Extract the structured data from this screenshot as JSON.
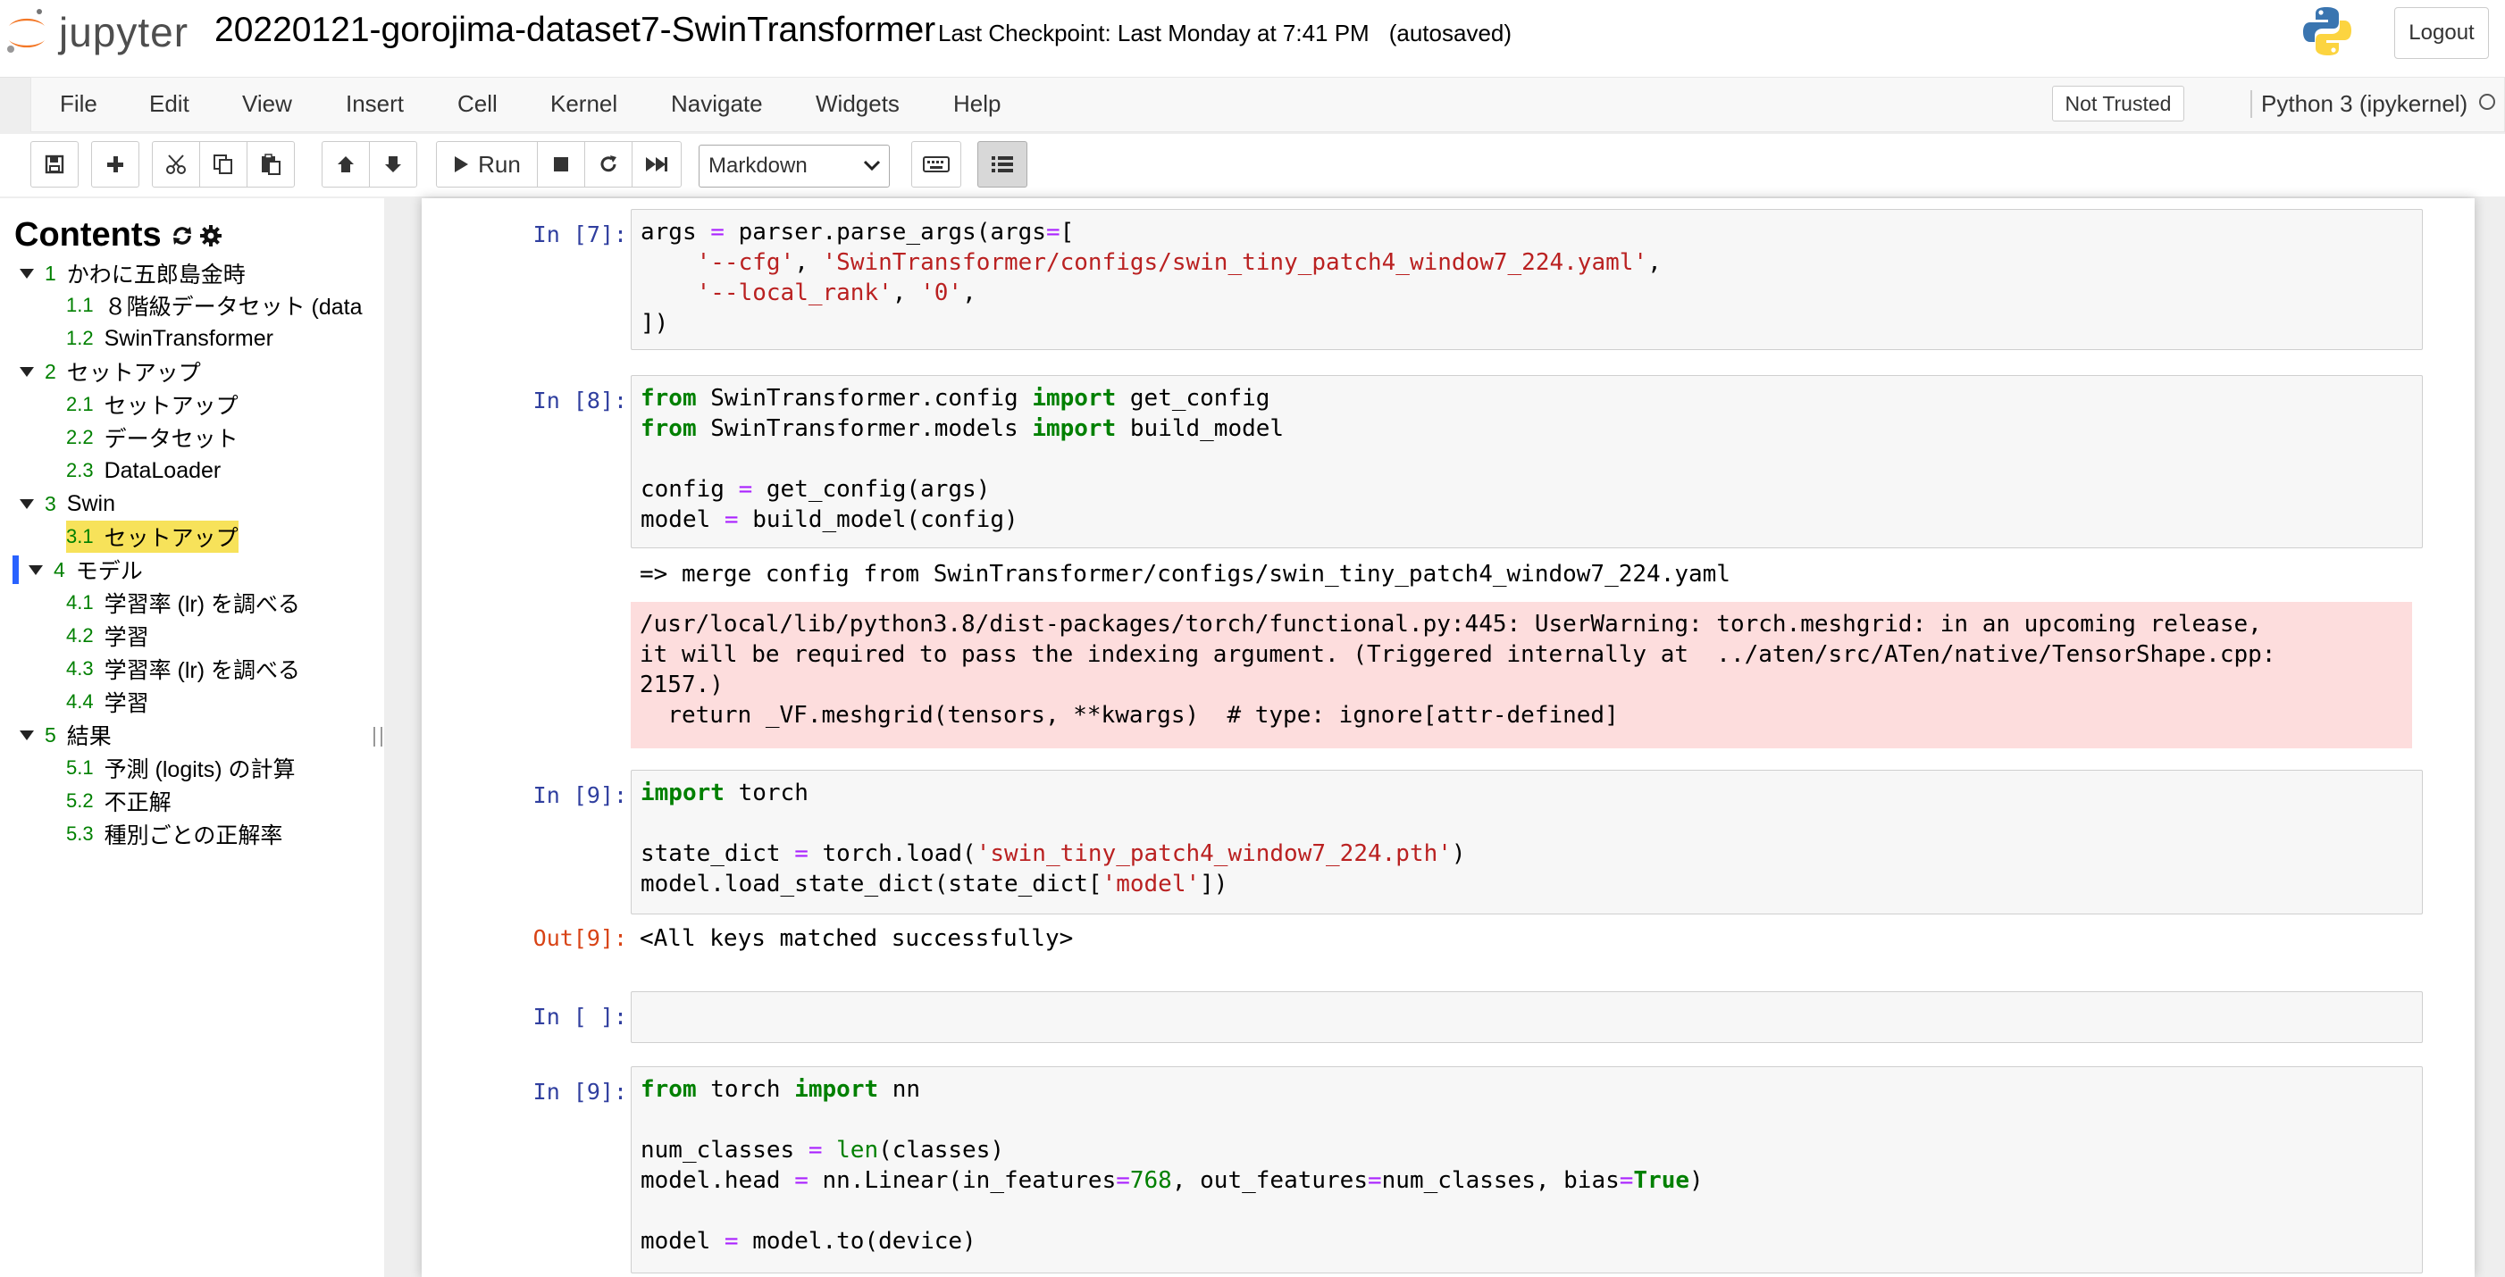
{
  "header": {
    "logo_text": "jupyter",
    "notebook_title": "20220121-gorojima-dataset7-SwinTransformer",
    "checkpoint": "Last Checkpoint: Last Monday at 7:41 PM",
    "autosaved": "(autosaved)",
    "logout_label": "Logout"
  },
  "menubar": {
    "items": [
      "File",
      "Edit",
      "View",
      "Insert",
      "Cell",
      "Kernel",
      "Navigate",
      "Widgets",
      "Help"
    ],
    "trust_label": "Not Trusted",
    "kernel_name": "Python 3 (ipykernel)"
  },
  "toolbar": {
    "run_label": "Run",
    "cell_type": "Markdown",
    "buttons": [
      "save-icon",
      "plus-icon",
      "cut-icon",
      "copy-icon",
      "paste-icon",
      "arrow-up-icon",
      "arrow-down-icon",
      "run-icon",
      "stop-icon",
      "restart-icon",
      "fast-forward-icon",
      "keyboard-icon",
      "toc-list-icon"
    ]
  },
  "toc": {
    "title": "Contents",
    "items": [
      {
        "num": "1",
        "label": "かわに五郎島金時",
        "level": 1
      },
      {
        "num": "1.1",
        "label": "８階級データセット (data",
        "level": 2
      },
      {
        "num": "1.2",
        "label": "SwinTransformer",
        "level": 2
      },
      {
        "num": "2",
        "label": "セットアップ",
        "level": 1
      },
      {
        "num": "2.1",
        "label": "セットアップ",
        "level": 2
      },
      {
        "num": "2.2",
        "label": "データセット",
        "level": 2
      },
      {
        "num": "2.3",
        "label": "DataLoader",
        "level": 2
      },
      {
        "num": "3",
        "label": "Swin",
        "level": 1
      },
      {
        "num": "3.1",
        "label": "セットアップ",
        "level": 2,
        "highlighted": true
      },
      {
        "num": "4",
        "label": "モデル",
        "level": 1,
        "current": true
      },
      {
        "num": "4.1",
        "label": "学習率 (lr) を調べる",
        "level": 2
      },
      {
        "num": "4.2",
        "label": "学習",
        "level": 2
      },
      {
        "num": "4.3",
        "label": "学習率 (lr) を調べる",
        "level": 2
      },
      {
        "num": "4.4",
        "label": "学習",
        "level": 2
      },
      {
        "num": "5",
        "label": "結果",
        "level": 1
      },
      {
        "num": "5.1",
        "label": "予測 (logits) の計算",
        "level": 2
      },
      {
        "num": "5.2",
        "label": "不正解",
        "level": 2
      },
      {
        "num": "5.3",
        "label": "種別ごとの正解率",
        "level": 2
      }
    ]
  },
  "cells": {
    "c7": {
      "prompt": "In [7]:",
      "lines": [
        [
          [
            "args ",
            ""
          ],
          [
            "=",
            "op"
          ],
          [
            " parser.parse_args(args",
            ""
          ],
          [
            "=",
            "op"
          ],
          [
            "[",
            ""
          ]
        ],
        [
          [
            "    ",
            ""
          ],
          [
            "'--cfg'",
            "str"
          ],
          [
            ", ",
            ""
          ],
          [
            "'SwinTransformer/configs/swin_tiny_patch4_window7_224.yaml'",
            "str"
          ],
          [
            ",",
            ""
          ]
        ],
        [
          [
            "    ",
            ""
          ],
          [
            "'--local_rank'",
            "str"
          ],
          [
            ", ",
            ""
          ],
          [
            "'0'",
            "str"
          ],
          [
            ",",
            ""
          ]
        ],
        [
          [
            "])",
            ""
          ]
        ]
      ]
    },
    "c8": {
      "prompt": "In [8]:",
      "lines": [
        [
          [
            "from",
            "kw"
          ],
          [
            " SwinTransformer.config ",
            ""
          ],
          [
            "import",
            "kw"
          ],
          [
            " get_config",
            ""
          ]
        ],
        [
          [
            "from",
            "kw"
          ],
          [
            " SwinTransformer.models ",
            ""
          ],
          [
            "import",
            "kw"
          ],
          [
            " build_model",
            ""
          ]
        ],
        [
          [
            "",
            ""
          ]
        ],
        [
          [
            "config ",
            ""
          ],
          [
            "=",
            "op"
          ],
          [
            " get_config(args)",
            ""
          ]
        ],
        [
          [
            "model ",
            ""
          ],
          [
            "=",
            "op"
          ],
          [
            " build_model(config)",
            ""
          ]
        ]
      ],
      "stdout": "=> merge config from SwinTransformer/configs/swin_tiny_patch4_window7_224.yaml",
      "stderr": [
        "/usr/local/lib/python3.8/dist-packages/torch/functional.py:445: UserWarning: torch.meshgrid: in an upcoming release,",
        "it will be required to pass the indexing argument. (Triggered internally at  ../aten/src/ATen/native/TensorShape.cpp:",
        "2157.)",
        "  return _VF.meshgrid(tensors, **kwargs)  # type: ignore[attr-defined]"
      ]
    },
    "c9a": {
      "prompt": "In [9]:",
      "lines": [
        [
          [
            "import",
            "kw"
          ],
          [
            " torch",
            ""
          ]
        ],
        [
          [
            "",
            ""
          ]
        ],
        [
          [
            "state_dict ",
            ""
          ],
          [
            "=",
            "op"
          ],
          [
            " torch.load(",
            ""
          ],
          [
            "'swin_tiny_patch4_window7_224.pth'",
            "str"
          ],
          [
            ")",
            ""
          ]
        ],
        [
          [
            "model.load_state_dict(state_dict[",
            ""
          ],
          [
            "'model'",
            "str"
          ],
          [
            "])",
            ""
          ]
        ]
      ],
      "out_prompt": "Out[9]:",
      "output": "<All keys matched successfully>"
    },
    "c_empty": {
      "prompt": "In [ ]:"
    },
    "c9b": {
      "prompt": "In [9]:",
      "lines": [
        [
          [
            "from",
            "kw"
          ],
          [
            " torch ",
            ""
          ],
          [
            "import",
            "kw"
          ],
          [
            " nn",
            ""
          ]
        ],
        [
          [
            "",
            ""
          ]
        ],
        [
          [
            "num_classes ",
            ""
          ],
          [
            "=",
            "op"
          ],
          [
            " ",
            ""
          ],
          [
            "len",
            "bi"
          ],
          [
            "(classes)",
            ""
          ]
        ],
        [
          [
            "model.head ",
            ""
          ],
          [
            "=",
            "op"
          ],
          [
            " nn.Linear(in_features",
            ""
          ],
          [
            "=",
            "op"
          ],
          [
            "768",
            "num"
          ],
          [
            ", out_features",
            ""
          ],
          [
            "=",
            "op"
          ],
          [
            "num_classes, bias",
            ""
          ],
          [
            "=",
            "op"
          ],
          [
            "True",
            "kw"
          ],
          [
            ")",
            ""
          ]
        ],
        [
          [
            "",
            ""
          ]
        ],
        [
          [
            "model ",
            ""
          ],
          [
            "=",
            "op"
          ],
          [
            " model.to(device)",
            ""
          ]
        ]
      ]
    }
  }
}
